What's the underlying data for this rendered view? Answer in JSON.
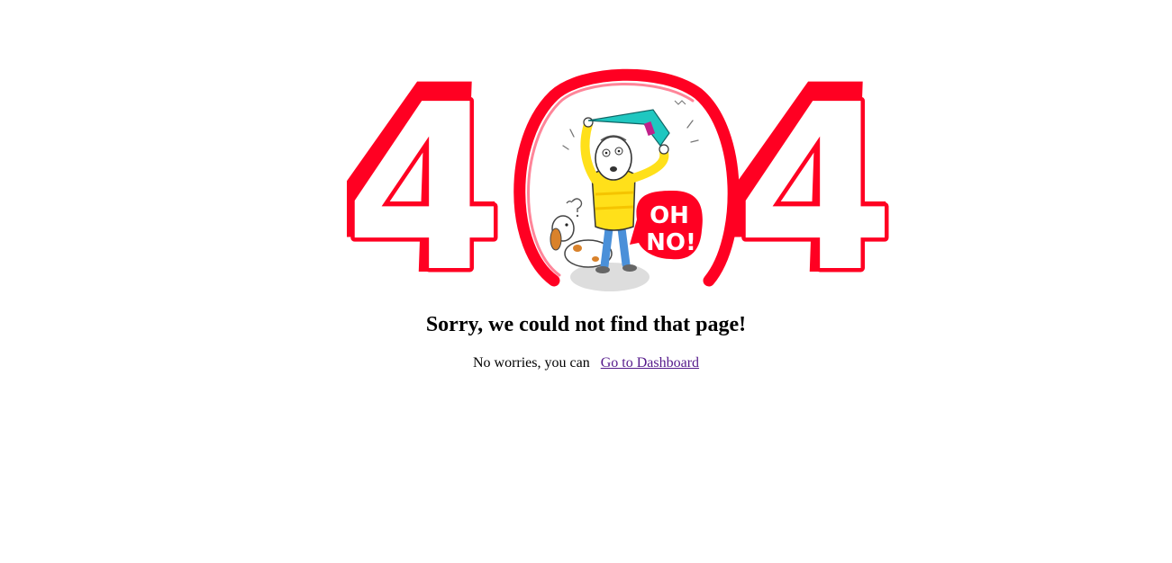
{
  "error": {
    "code_left_digit": "4",
    "code_right_digit": "4",
    "speech_bubble_line1": "OH",
    "speech_bubble_line2": "NO!",
    "heading": "Sorry, we could not find that page!",
    "message_prefix": "No worries, you can",
    "dashboard_link_label": "Go to Dashboard"
  },
  "colors": {
    "accent_red": "#ff0022",
    "link_visited": "#551a8b",
    "shirt_yellow": "#ffe01a",
    "book_teal": "#1fc7c0",
    "book_magenta": "#c0208a"
  },
  "icons": {
    "illustration": "404-oh-no-illustration",
    "character": "frustrated-boy-with-book",
    "dog": "confused-dog"
  }
}
